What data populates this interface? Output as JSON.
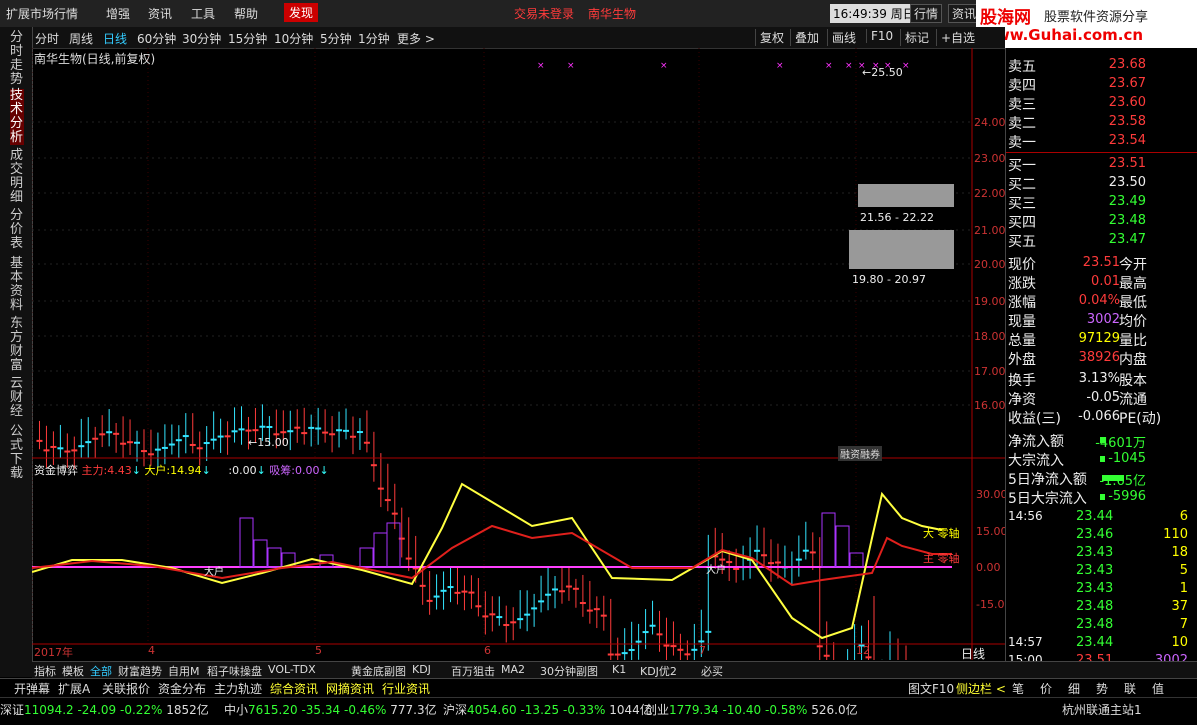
{
  "menu": {
    "items": [
      "扩展市场行情",
      "增强",
      "资讯",
      "工具",
      "帮助"
    ],
    "discover": "发现",
    "trade_status": "交易未登录",
    "stock_name": "南华生物",
    "time": "16:49:39",
    "weekday": "周日",
    "quote_button": "行情",
    "info_button": "资讯",
    "logo_text": "股海网",
    "logo_slogan": "股票软件资源分享",
    "logo_url": "www.Guhai.com.cn"
  },
  "timeframes": [
    "分时",
    "周线",
    "日线",
    "60分钟",
    "30分钟",
    "15分钟",
    "10分钟",
    "5分钟",
    "1分钟",
    "更多 >"
  ],
  "active_timeframe": "日线",
  "toolbar": [
    "复权",
    "叠加",
    "画线",
    "F10",
    "标记",
    "+自选"
  ],
  "left_tabs": [
    "分时走势",
    "技术分析",
    "成交明细",
    "分价表",
    "基本资料",
    "东方财富",
    "云财经",
    "公式下载"
  ],
  "chart_title": "南华生物(日线,前复权)",
  "price_axis": [
    "24.00",
    "23.00",
    "22.00",
    "21.00",
    "20.00",
    "19.00",
    "18.00",
    "17.00",
    "16.00"
  ],
  "annotations": {
    "high": "25.50",
    "low": "15.00",
    "zone_upper": "21.56 - 22.22",
    "zone_lower": "19.80 - 20.97",
    "tag": "融资融券"
  },
  "indicator": {
    "name": "资金博弈",
    "main_label": "主力:",
    "main_value": "4.43",
    "big_label": "大户:",
    "big_value": "14.94",
    "mid_label": ":",
    "mid_value": "0.00",
    "absorb_label": "吸筹:",
    "absorb_value": "0.00",
    "axis": [
      "30.00",
      "15.00",
      "0.00",
      "-15.00"
    ],
    "right_labels": [
      "大 零轴",
      "主 零轴"
    ],
    "inline_labels": [
      "大户",
      "大户"
    ]
  },
  "date_axis": [
    "2017年",
    "4",
    "5",
    "6",
    "7",
    "12"
  ],
  "date_axis_right": "日线",
  "orderbook": {
    "sell": [
      {
        "label": "卖五",
        "price": "23.68"
      },
      {
        "label": "卖四",
        "price": "23.67"
      },
      {
        "label": "卖三",
        "price": "23.60"
      },
      {
        "label": "卖二",
        "price": "23.58"
      },
      {
        "label": "卖一",
        "price": "23.54"
      }
    ],
    "buy": [
      {
        "label": "买一",
        "price": "23.51"
      },
      {
        "label": "买二",
        "price": "23.50"
      },
      {
        "label": "买三",
        "price": "23.49"
      },
      {
        "label": "买四",
        "price": "23.48"
      },
      {
        "label": "买五",
        "price": "23.47"
      }
    ]
  },
  "stats": [
    {
      "label": "现价",
      "value": "23.51",
      "label2": "今开"
    },
    {
      "label": "涨跌",
      "value": "0.01",
      "label2": "最高"
    },
    {
      "label": "涨幅",
      "value": "0.04%",
      "label2": "最低"
    },
    {
      "label": "现量",
      "value": "3002",
      "label2": "均价"
    },
    {
      "label": "总量",
      "value": "97129",
      "label2": "量比"
    },
    {
      "label": "外盘",
      "value": "38926",
      "label2": "内盘"
    },
    {
      "label": "换手",
      "value": "3.13%",
      "label2": "股本"
    },
    {
      "label": "净资",
      "value": "-0.05",
      "label2": "流通"
    },
    {
      "label": "收益(三)",
      "value": "-0.066",
      "label2": "PE(动)"
    }
  ],
  "flows": [
    {
      "label": "净流入额",
      "value": "-4601万"
    },
    {
      "label": "大宗流入",
      "value": "-1045"
    },
    {
      "label": "5日净流入额",
      "value": "-1.65亿"
    },
    {
      "label": "5日大宗流入",
      "value": "-5996"
    }
  ],
  "ticks": [
    {
      "time": "14:56",
      "price": "23.44",
      "vol": "6"
    },
    {
      "time": "",
      "price": "23.46",
      "vol": "110"
    },
    {
      "time": "",
      "price": "23.43",
      "vol": "18"
    },
    {
      "time": "",
      "price": "23.43",
      "vol": "5"
    },
    {
      "time": "",
      "price": "23.43",
      "vol": "1"
    },
    {
      "time": "",
      "price": "23.48",
      "vol": "37"
    },
    {
      "time": "",
      "price": "23.48",
      "vol": "7"
    },
    {
      "time": "14:57",
      "price": "23.44",
      "vol": "10"
    },
    {
      "time": "15:00",
      "price": "23.51",
      "vol": "3002"
    }
  ],
  "bottom_tabs": [
    "指标",
    "模板",
    "全部",
    "财富趋势",
    "自用M",
    "稻子味操盘",
    "VOL-TDX",
    "黄金底副图",
    "KDJ",
    "百万狙击",
    "MA2",
    "30分钟副图",
    "K1",
    "KDJ优2",
    "必买"
  ],
  "section_tabs": [
    "开弹幕",
    "扩展A",
    "关联报价",
    "资金分布",
    "主力轨迹",
    "综合资讯",
    "网摘资讯",
    "行业资讯"
  ],
  "section_right": [
    "图文F10",
    "侧边栏 <",
    "笔",
    "价",
    "细",
    "势",
    "联",
    "值"
  ],
  "status": [
    {
      "name": "深证",
      "value": "11094.2",
      "chg": "-24.09",
      "pct": "-0.22%",
      "amt": "1852亿"
    },
    {
      "name": "中小",
      "value": "7615.20",
      "chg": "-35.34",
      "pct": "-0.46%",
      "amt": "777.3亿"
    },
    {
      "name": "沪深",
      "value": "4054.60",
      "chg": "-13.25",
      "pct": "-0.33%",
      "amt": "1044亿"
    },
    {
      "name": "创业",
      "value": "1779.34",
      "chg": "-10.40",
      "pct": "-0.58%",
      "amt": "526.0亿"
    }
  ],
  "station": "杭州联通主站1",
  "colors": {
    "up": "#ff3b3b",
    "down": "#33e5ff",
    "main_line": "#e0201c",
    "big_line": "#ffff40",
    "zero_line": "#ff40ff"
  }
}
